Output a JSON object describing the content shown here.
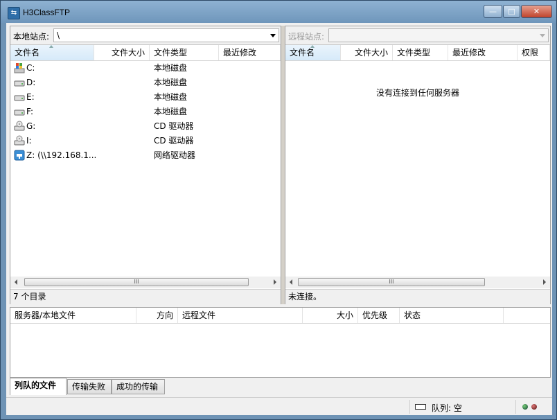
{
  "window": {
    "title": "H3ClassFTP",
    "icon": "ftp-app-icon"
  },
  "local": {
    "site_label": "本地站点:",
    "path_value": "\\",
    "columns": [
      "文件名",
      "文件大小",
      "文件类型",
      "最近修改"
    ],
    "rows": [
      {
        "name": "C:",
        "type": "本地磁盘",
        "icon": "system-drive-icon"
      },
      {
        "name": "D:",
        "type": "本地磁盘",
        "icon": "hard-drive-icon"
      },
      {
        "name": "E:",
        "type": "本地磁盘",
        "icon": "hard-drive-icon"
      },
      {
        "name": "F:",
        "type": "本地磁盘",
        "icon": "hard-drive-icon"
      },
      {
        "name": "G:",
        "type": "CD 驱动器",
        "icon": "cd-drive-icon"
      },
      {
        "name": "I:",
        "type": "CD 驱动器",
        "icon": "cd-drive-icon"
      },
      {
        "name": "Z: (\\\\192.168.1...",
        "type": "网络驱动器",
        "icon": "network-drive-icon"
      }
    ],
    "status": "7 个目录"
  },
  "remote": {
    "site_label": "远程站点:",
    "path_value": "",
    "columns": [
      "文件名",
      "文件大小",
      "文件类型",
      "最近修改",
      "权限"
    ],
    "empty_message": "没有连接到任何服务器",
    "status": "未连接。"
  },
  "queue": {
    "columns": [
      "服务器/本地文件",
      "方向",
      "远程文件",
      "大小",
      "优先级",
      "状态"
    ]
  },
  "tabs": [
    "列队的文件",
    "传输失败",
    "成功的传输"
  ],
  "statusbar": {
    "queue_label": "队列: 空"
  }
}
